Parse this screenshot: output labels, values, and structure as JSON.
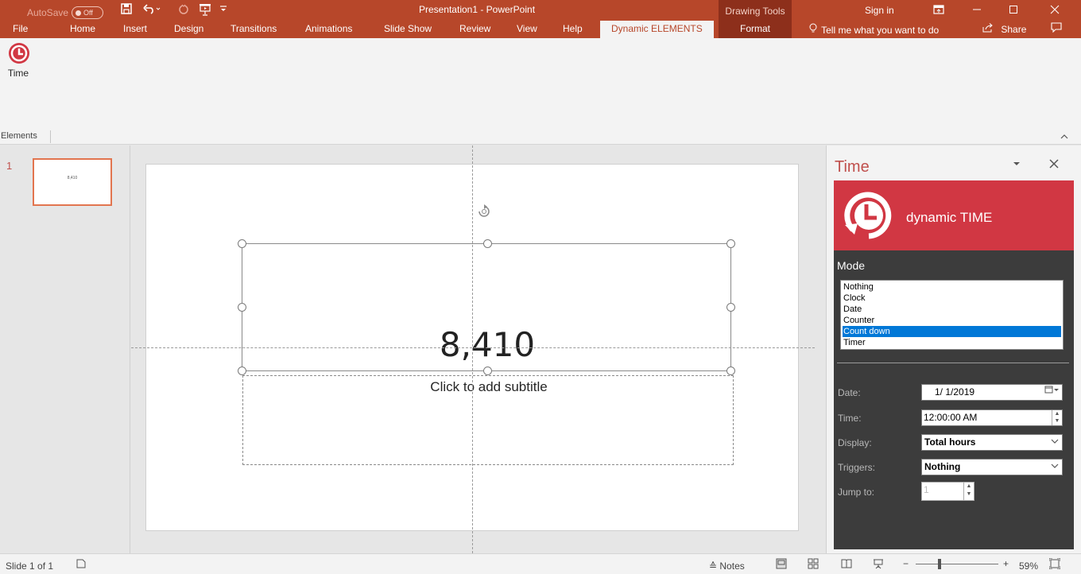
{
  "titlebar": {
    "autosave_label": "AutoSave",
    "autosave_state": "Off",
    "doc_title": "Presentation1  -  PowerPoint",
    "drawing_tools": "Drawing Tools",
    "sign_in": "Sign in"
  },
  "tabs": [
    "File",
    "Home",
    "Insert",
    "Design",
    "Transitions",
    "Animations",
    "Slide Show",
    "Review",
    "View",
    "Help",
    "Dynamic ELEMENTS",
    "Format"
  ],
  "tell_me": "Tell me what you want to do",
  "share": "Share",
  "ribbon": {
    "time_button": "Time",
    "group_label": "Elements"
  },
  "thumbnails": [
    {
      "number": "1",
      "preview_text": "8,410"
    }
  ],
  "slide": {
    "title_value": "8,410",
    "subtitle_placeholder": "Click to add subtitle"
  },
  "pane": {
    "title": "Time",
    "banner": "dynamic TIME",
    "mode_label": "Mode",
    "mode_options": [
      "Nothing",
      "Clock",
      "Date",
      "Counter",
      "Count down",
      "Timer"
    ],
    "mode_selected": "Count down",
    "date_label": "Date:",
    "date_value": "1/  1/2019",
    "time_label": "Time:",
    "time_value": "12:00:00 AM",
    "display_label": "Display:",
    "display_value": "Total hours",
    "triggers_label": "Triggers:",
    "triggers_value": "Nothing",
    "jump_label": "Jump to:",
    "jump_value": "1"
  },
  "status": {
    "slide_info": "Slide 1 of 1",
    "notes": "Notes",
    "zoom": "59%"
  },
  "colors": {
    "accent": "#b7472a",
    "banner": "#d13743",
    "pane_body": "#3c3c3c",
    "selection": "#0078d7"
  }
}
